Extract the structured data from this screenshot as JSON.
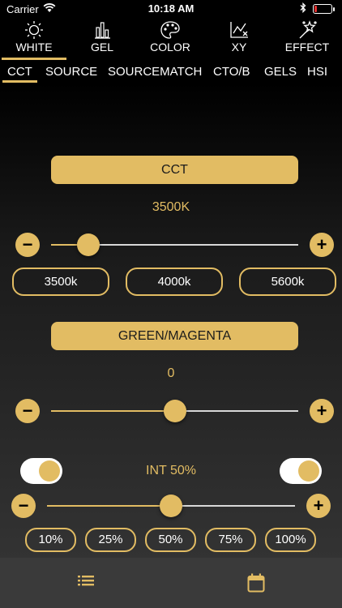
{
  "status_bar": {
    "carrier": "Carrier",
    "time": "10:18 AM",
    "battery_level": 0.15,
    "icons": [
      "wifi-icon",
      "bluetooth-icon",
      "battery-icon"
    ]
  },
  "mode_tabs": [
    {
      "label": "WHITE",
      "icon": "sun-icon",
      "active": true
    },
    {
      "label": "GEL",
      "icon": "bar-chart-icon",
      "active": false
    },
    {
      "label": "COLOR",
      "icon": "palette-icon",
      "active": false
    },
    {
      "label": "XY",
      "icon": "xy-graph-icon",
      "active": false
    },
    {
      "label": "EFFECT",
      "icon": "magic-wand-icon",
      "active": false
    }
  ],
  "sub_tabs": [
    {
      "label": "CCT",
      "active": true
    },
    {
      "label": "SOURCE",
      "active": false
    },
    {
      "label": "SOURCEMATCH",
      "active": false
    },
    {
      "label": "CTO/B",
      "active": false
    },
    {
      "label": "GELS",
      "active": false
    },
    {
      "label": "HSI",
      "active": false
    }
  ],
  "cct": {
    "header": "CCT",
    "value": "3500K",
    "slider_fraction": 0.15,
    "minus": "−",
    "plus": "+",
    "presets": [
      "3500k",
      "4000k",
      "5600k"
    ]
  },
  "green_magenta": {
    "header": "GREEN/MAGENTA",
    "value": "0",
    "slider_fraction": 0.5,
    "minus": "−",
    "plus": "+"
  },
  "intensity": {
    "label": "INT  50%",
    "slider_fraction": 0.5,
    "left_toggle_on": true,
    "right_toggle_on": true,
    "minus": "−",
    "plus": "+",
    "presets": [
      "10%",
      "25%",
      "50%",
      "75%",
      "100%"
    ]
  },
  "bottom_bar": {
    "icons": [
      "list-icon",
      "calendar-icon"
    ]
  },
  "colors": {
    "accent": "#e2bc63",
    "track": "#d8d8d8",
    "bottom_bar": "#3a3a3a",
    "battery_low": "#e3302f"
  }
}
